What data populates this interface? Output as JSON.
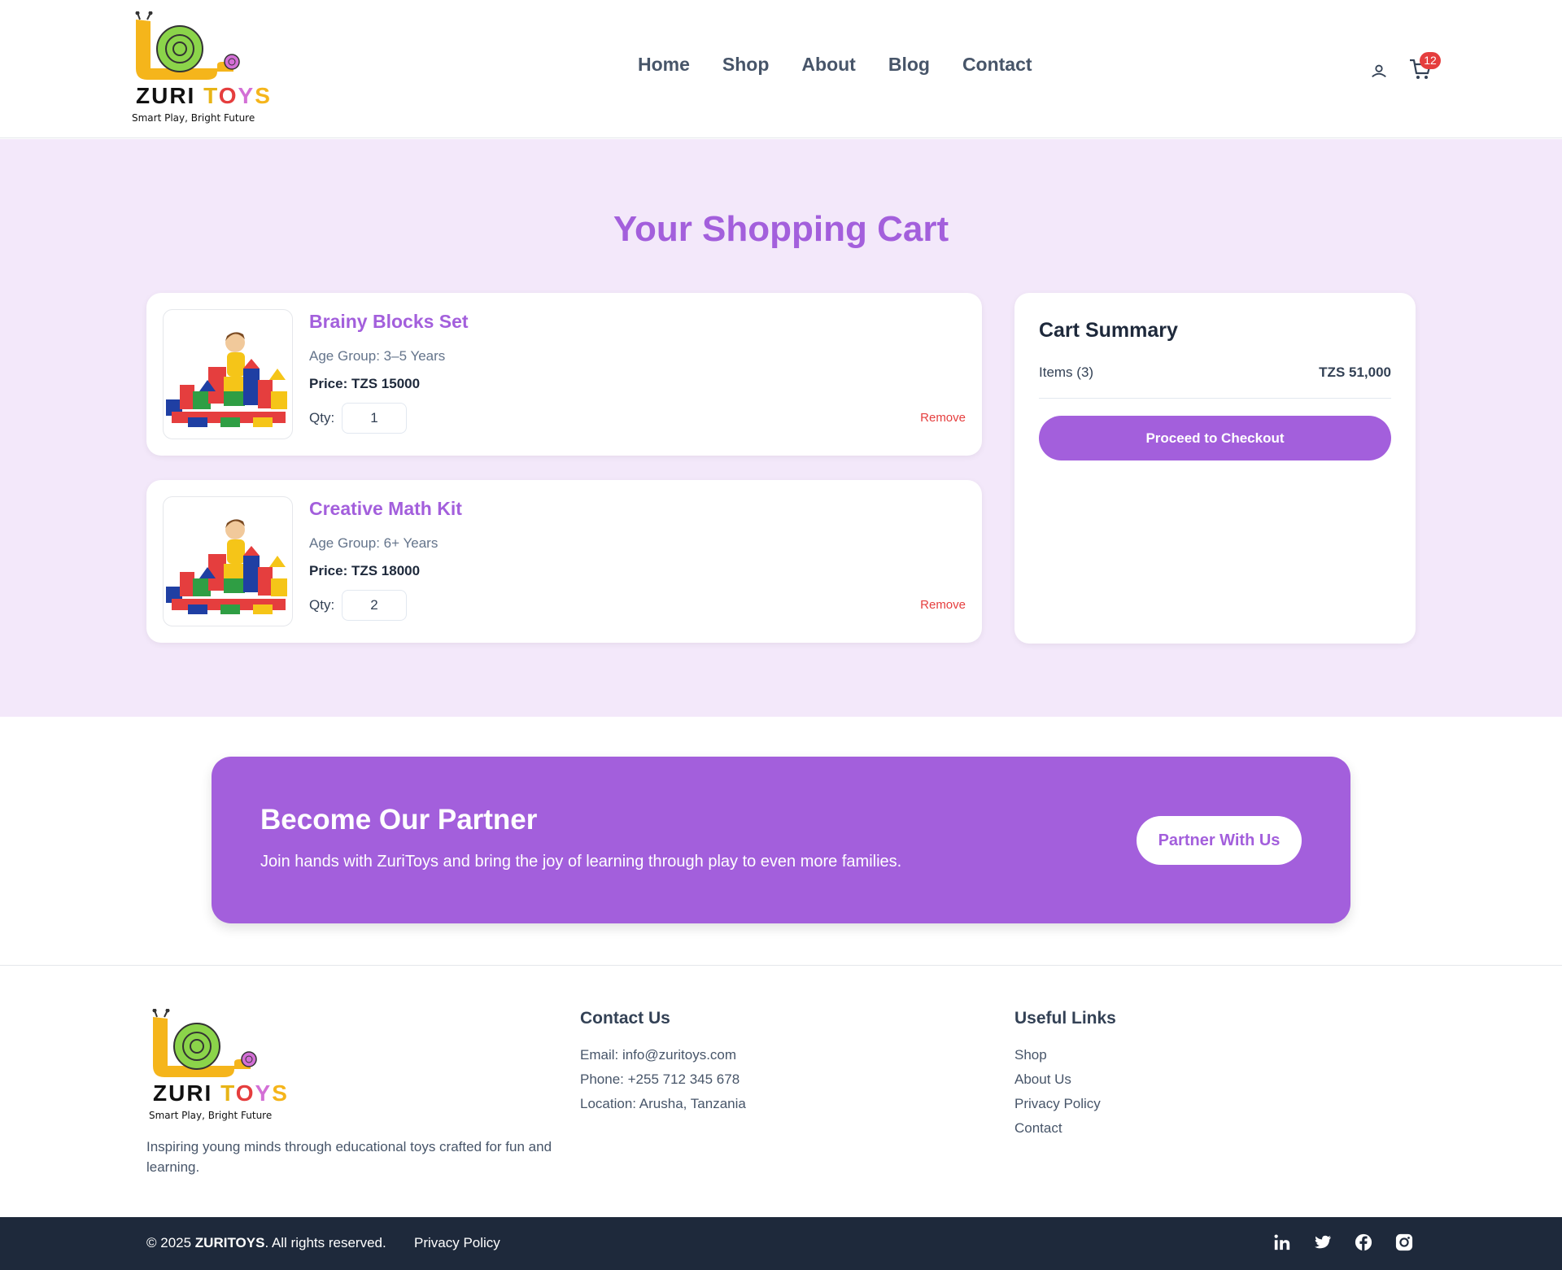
{
  "brand": {
    "name": "ZURI TOYS",
    "tagline": "Smart Play, Bright Future"
  },
  "nav": {
    "items": [
      "Home",
      "Shop",
      "About",
      "Blog",
      "Contact"
    ]
  },
  "header": {
    "cart_count": "12"
  },
  "page": {
    "title": "Your Shopping Cart"
  },
  "cart": {
    "items": [
      {
        "name": "Brainy Blocks Set",
        "age_group": "Age Group: 3–5 Years",
        "price": "Price: TZS 15000",
        "qty_label": "Qty:",
        "qty": "1",
        "remove_label": "Remove"
      },
      {
        "name": "Creative Math Kit",
        "age_group": "Age Group: 6+ Years",
        "price": "Price: TZS 18000",
        "qty_label": "Qty:",
        "qty": "2",
        "remove_label": "Remove"
      }
    ]
  },
  "summary": {
    "title": "Cart Summary",
    "items_label": "Items (3)",
    "total": "TZS 51,000",
    "checkout_label": "Proceed to Checkout"
  },
  "partner": {
    "title": "Become Our Partner",
    "text": "Join hands with ZuriToys and bring the joy of learning through play to even more families.",
    "button_label": "Partner With Us"
  },
  "footer": {
    "about": "Inspiring young minds through educational toys crafted for fun and learning.",
    "contact": {
      "heading": "Contact Us",
      "email": "Email: info@zuritoys.com",
      "phone": "Phone: +255 712 345 678",
      "location": "Location: Arusha, Tanzania"
    },
    "links": {
      "heading": "Useful Links",
      "items": [
        "Shop",
        "About Us",
        "Privacy Policy",
        "Contact"
      ]
    },
    "copyright_prefix": "© 2025 ",
    "copyright_brand": "ZURITOYS",
    "copyright_suffix": ". All rights reserved.",
    "privacy_label": "Privacy Policy",
    "social_icons": [
      "linkedin-icon",
      "twitter-icon",
      "facebook-icon",
      "instagram-icon"
    ]
  },
  "colors": {
    "accent": "#a35fdc",
    "cart_bg": "#f3e8fa",
    "danger": "#e53e3e",
    "footer_bar": "#1e293b"
  }
}
